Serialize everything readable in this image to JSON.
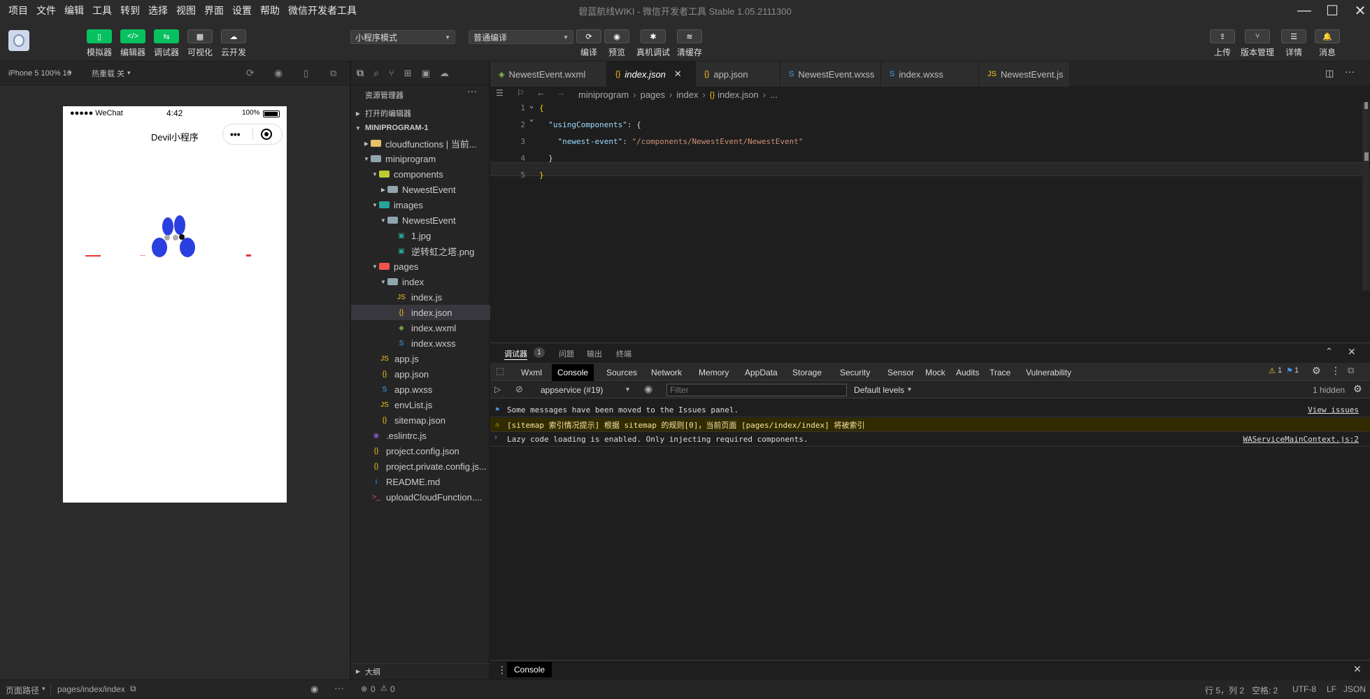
{
  "menu": [
    "项目",
    "文件",
    "编辑",
    "工具",
    "转到",
    "选择",
    "视图",
    "界面",
    "设置",
    "帮助",
    "微信开发者工具"
  ],
  "window_title": "碧蓝航线WIKI - 微信开发者工具 Stable 1.05.2111300",
  "toolbar": {
    "left_buttons": [
      {
        "label": "模拟器",
        "icon": "phone-icon"
      },
      {
        "label": "编辑器",
        "icon": "code-icon"
      },
      {
        "label": "调试器",
        "icon": "debug-icon"
      },
      {
        "label": "可视化",
        "icon": "layout-icon"
      },
      {
        "label": "云开发",
        "icon": "cloud-icon"
      }
    ],
    "mode_select": "小程序模式",
    "compile_select": "普通编译",
    "mid_buttons": [
      {
        "label": "编译",
        "icon": "refresh-icon"
      },
      {
        "label": "预览",
        "icon": "eye-icon"
      },
      {
        "label": "真机调试",
        "icon": "bug-icon"
      },
      {
        "label": "清缓存",
        "icon": "layers-icon"
      }
    ],
    "right_buttons": [
      {
        "label": "上传",
        "icon": "upload-icon"
      },
      {
        "label": "版本管理",
        "icon": "branch-icon"
      },
      {
        "label": "详情",
        "icon": "menu-icon"
      },
      {
        "label": "消息",
        "icon": "bell-icon"
      }
    ]
  },
  "simulator": {
    "device": "iPhone 5 100% 16",
    "hot_reload": "热重载 关",
    "status_carrier": "●●●●● WeChat",
    "status_time": "4:42",
    "status_battery": "100%",
    "nav_title": "Devil小程序",
    "capsule_more": "•••"
  },
  "explorer": {
    "title": "资源管理器",
    "open_editors": "打开的编辑器",
    "project": "MINIPROGRAM-1",
    "outline": "大纲",
    "items": [
      {
        "label": "cloudfunctions | 当前...",
        "depth": 1,
        "twisty": "▶",
        "icon": "folder-icon",
        "color": "#e8c06a"
      },
      {
        "label": "miniprogram",
        "depth": 1,
        "twisty": "▼",
        "icon": "folder-open-icon",
        "color": "#90a4ae"
      },
      {
        "label": "components",
        "depth": 2,
        "twisty": "▼",
        "icon": "folder-open-icon",
        "color": "#c0ca33"
      },
      {
        "label": "NewestEvent",
        "depth": 3,
        "twisty": "▶",
        "icon": "folder-icon",
        "color": "#90a4ae"
      },
      {
        "label": "images",
        "depth": 2,
        "twisty": "▼",
        "icon": "folder-open-icon",
        "color": "#26a69a"
      },
      {
        "label": "NewestEvent",
        "depth": 3,
        "twisty": "▼",
        "icon": "folder-open-icon",
        "color": "#90a4ae"
      },
      {
        "label": "1.jpg",
        "depth": 4,
        "twisty": "",
        "icon": "image-file-icon",
        "color": "#26a69a"
      },
      {
        "label": "逆转虹之塔.png",
        "depth": 4,
        "twisty": "",
        "icon": "image-file-icon",
        "color": "#26a69a"
      },
      {
        "label": "pages",
        "depth": 2,
        "twisty": "▼",
        "icon": "folder-open-icon",
        "color": "#ef5350"
      },
      {
        "label": "index",
        "depth": 3,
        "twisty": "▼",
        "icon": "folder-open-icon",
        "color": "#90a4ae"
      },
      {
        "label": "index.js",
        "depth": 4,
        "twisty": "",
        "icon": "js-file-icon",
        "color": "#f5c518"
      },
      {
        "label": "index.json",
        "depth": 4,
        "twisty": "",
        "icon": "json-file-icon",
        "color": "#f5c518"
      },
      {
        "label": "index.wxml",
        "depth": 4,
        "twisty": "",
        "icon": "wxml-file-icon",
        "color": "#8bc34a"
      },
      {
        "label": "index.wxss",
        "depth": 4,
        "twisty": "",
        "icon": "wxss-file-icon",
        "color": "#42a5f5"
      },
      {
        "label": "app.js",
        "depth": 2,
        "twisty": "",
        "icon": "js-file-icon",
        "color": "#f5c518"
      },
      {
        "label": "app.json",
        "depth": 2,
        "twisty": "",
        "icon": "json-file-icon",
        "color": "#f5c518"
      },
      {
        "label": "app.wxss",
        "depth": 2,
        "twisty": "",
        "icon": "wxss-file-icon",
        "color": "#42a5f5"
      },
      {
        "label": "envList.js",
        "depth": 2,
        "twisty": "",
        "icon": "js-file-icon",
        "color": "#f5c518"
      },
      {
        "label": "sitemap.json",
        "depth": 2,
        "twisty": "",
        "icon": "json-file-icon",
        "color": "#f5c518"
      },
      {
        "label": ".eslintrc.js",
        "depth": 1,
        "twisty": "",
        "icon": "eslint-icon",
        "color": "#7e57c2"
      },
      {
        "label": "project.config.json",
        "depth": 1,
        "twisty": "",
        "icon": "json-file-icon",
        "color": "#f5c518"
      },
      {
        "label": "project.private.config.js...",
        "depth": 1,
        "twisty": "",
        "icon": "json-file-icon",
        "color": "#f5c518"
      },
      {
        "label": "README.md",
        "depth": 1,
        "twisty": "",
        "icon": "info-icon",
        "color": "#42a5f5"
      },
      {
        "label": "uploadCloudFunction....",
        "depth": 1,
        "twisty": "",
        "icon": "terminal-file-icon",
        "color": "#ef5350"
      }
    ]
  },
  "editor": {
    "tabs": [
      {
        "label": "NewestEvent.wxml",
        "icon": "wxml-file-icon",
        "color": "#8bc34a",
        "active": false
      },
      {
        "label": "index.json",
        "icon": "json-file-icon",
        "color": "#f5c518",
        "active": true
      },
      {
        "label": "app.json",
        "icon": "json-file-icon",
        "color": "#f5c518",
        "active": false
      },
      {
        "label": "NewestEvent.wxss",
        "icon": "wxss-file-icon",
        "color": "#42a5f5",
        "active": false
      },
      {
        "label": "index.wxss",
        "icon": "wxss-file-icon",
        "color": "#42a5f5",
        "active": false
      },
      {
        "label": "NewestEvent.js",
        "icon": "js-file-icon",
        "color": "#f5c518",
        "active": false
      }
    ],
    "breadcrumb": [
      "miniprogram",
      "pages",
      "index",
      "index.json",
      "..."
    ],
    "lines": [
      {
        "n": "1",
        "parts": [
          {
            "t": "{",
            "c": "#ffd700"
          }
        ]
      },
      {
        "n": "2",
        "parts": [
          {
            "t": "  \"usingComponents\"",
            "c": "#9cdcfe"
          },
          {
            "t": ": {",
            "c": "#d4d4d4"
          }
        ]
      },
      {
        "n": "3",
        "parts": [
          {
            "t": "    \"newest-event\"",
            "c": "#9cdcfe"
          },
          {
            "t": ": ",
            "c": "#d4d4d4"
          },
          {
            "t": "\"/components/NewestEvent/NewestEvent\"",
            "c": "#ce9178"
          }
        ]
      },
      {
        "n": "4",
        "parts": [
          {
            "t": "  }",
            "c": "#d4d4d4"
          }
        ]
      },
      {
        "n": "5",
        "parts": [
          {
            "t": "}",
            "c": "#ffd700"
          }
        ]
      }
    ]
  },
  "devtools": {
    "top_tabs": [
      "调试器",
      "问题",
      "输出",
      "终端"
    ],
    "badge": "1",
    "tabs": [
      "Wxml",
      "Console",
      "Sources",
      "Network",
      "Memory",
      "AppData",
      "Storage",
      "Security",
      "Sensor",
      "Mock",
      "Audits",
      "Trace",
      "Vulnerability"
    ],
    "warn_count": "1",
    "info_count": "1",
    "context": "appservice (#19)",
    "filter_placeholder": "Filter",
    "levels": "Default levels",
    "hidden": "1 hidden",
    "messages": [
      {
        "text": "Some messages have been moved to the Issues panel.",
        "link": "View issues",
        "type": "info"
      },
      {
        "text": "[sitemap 索引情况提示] 根据 sitemap 的规则[0]，当前页面 [pages/index/index] 将被索引",
        "link": "",
        "type": "warn"
      },
      {
        "text": "Lazy code loading is enabled. Only injecting required components.",
        "link": "WAServiceMainContext.js:2",
        "type": "log"
      }
    ],
    "drawer_tab": "Console"
  },
  "statusbar": {
    "page_path_label": "页面路径",
    "page_path": "pages/index/index",
    "errors": "0",
    "warnings": "0",
    "position": "行 5，列 2",
    "spaces": "空格: 2",
    "encoding": "UTF-8",
    "eol": "LF",
    "language": "JSON"
  }
}
